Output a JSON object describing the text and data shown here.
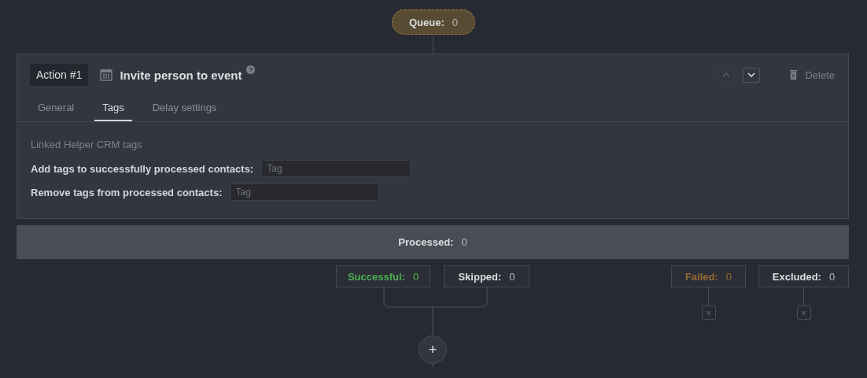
{
  "queue": {
    "label": "Queue:",
    "count": "0"
  },
  "action": {
    "badge": "Action #1",
    "title": "Invite person to event",
    "help": "?",
    "move_up": {
      "disabled": true
    },
    "move_down": {
      "disabled": false
    },
    "delete": "Delete"
  },
  "tabs": [
    {
      "label": "General",
      "selected": false
    },
    {
      "label": "Tags",
      "selected": true
    },
    {
      "label": "Delay settings",
      "selected": false
    }
  ],
  "section_title": "Linked Helper CRM tags",
  "fields": [
    {
      "label": "Add tags to successfully processed contacts:",
      "placeholder": "Tag"
    },
    {
      "label": "Remove tags from processed contacts:",
      "placeholder": "Tag"
    }
  ],
  "processed": {
    "label": "Processed:",
    "count": "0"
  },
  "results": [
    {
      "kind": "success",
      "label": "Successful:",
      "count": "0",
      "end": "+"
    },
    {
      "kind": "skip",
      "label": "Skipped:",
      "count": "0"
    },
    {
      "kind": "fail",
      "label": "Failed:",
      "count": "0",
      "end": "X"
    },
    {
      "kind": "exclude",
      "label": "Excluded:",
      "count": "0",
      "end": "X"
    }
  ]
}
